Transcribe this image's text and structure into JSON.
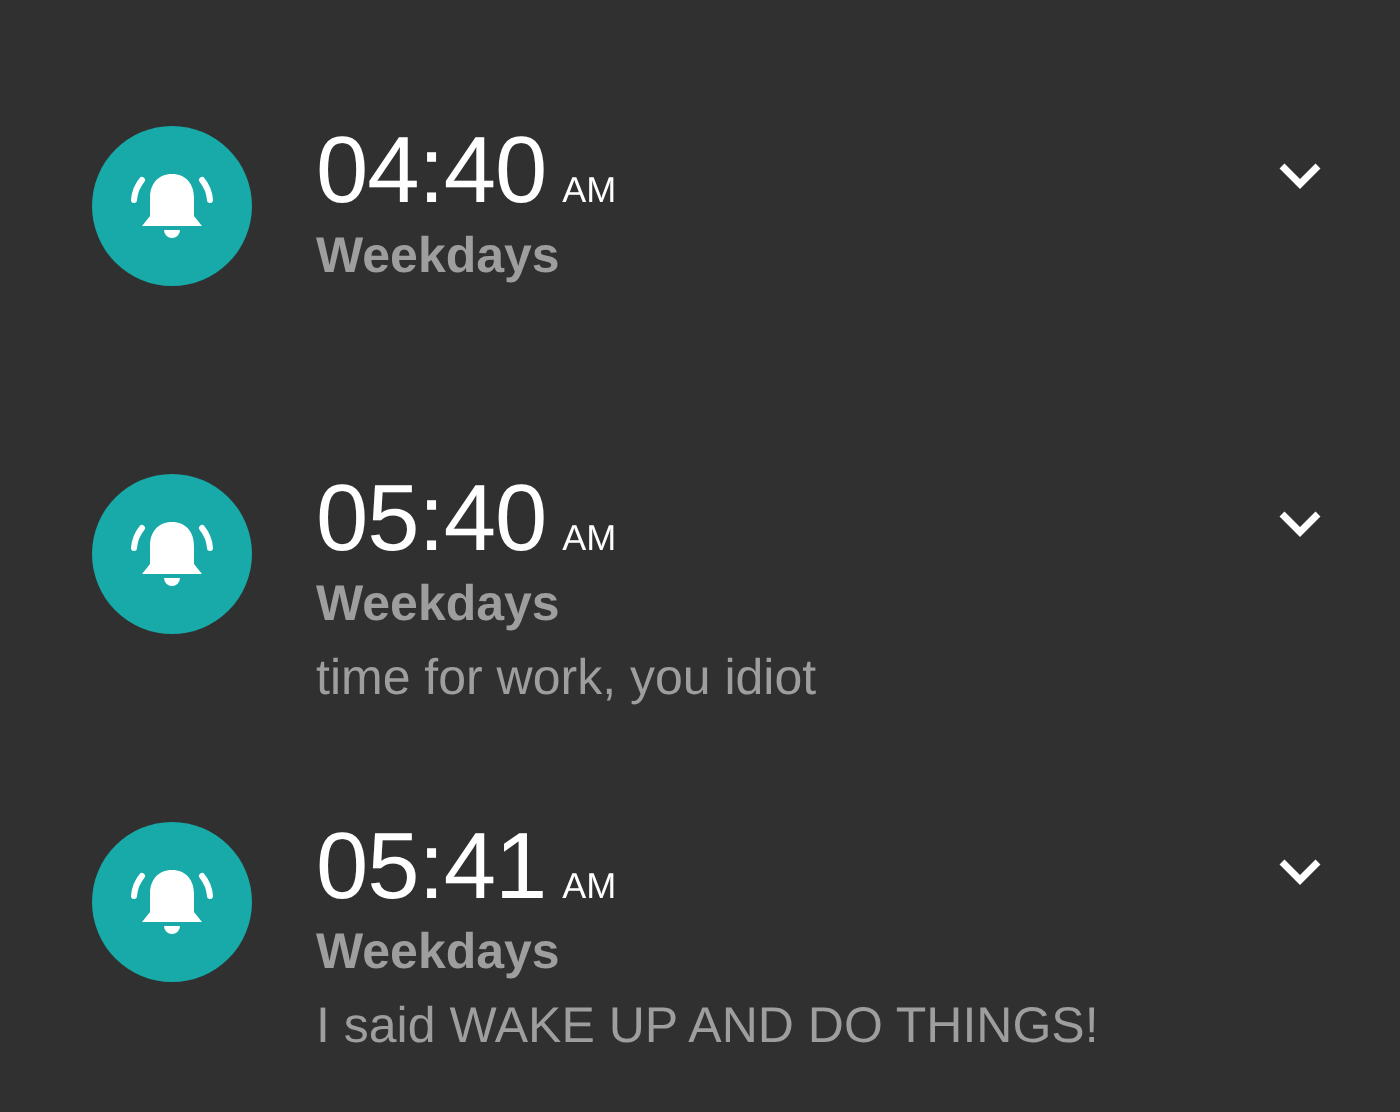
{
  "alarms": [
    {
      "time": "04:40",
      "period": "AM",
      "repeat": "Weekdays"
    },
    {
      "time": "05:40",
      "period": "AM",
      "repeat": "Weekdays",
      "label": "time for work, you idiot"
    },
    {
      "time": "05:41",
      "period": "AM",
      "repeat": "Weekdays",
      "label": "I said WAKE UP AND DO THINGS!"
    }
  ]
}
